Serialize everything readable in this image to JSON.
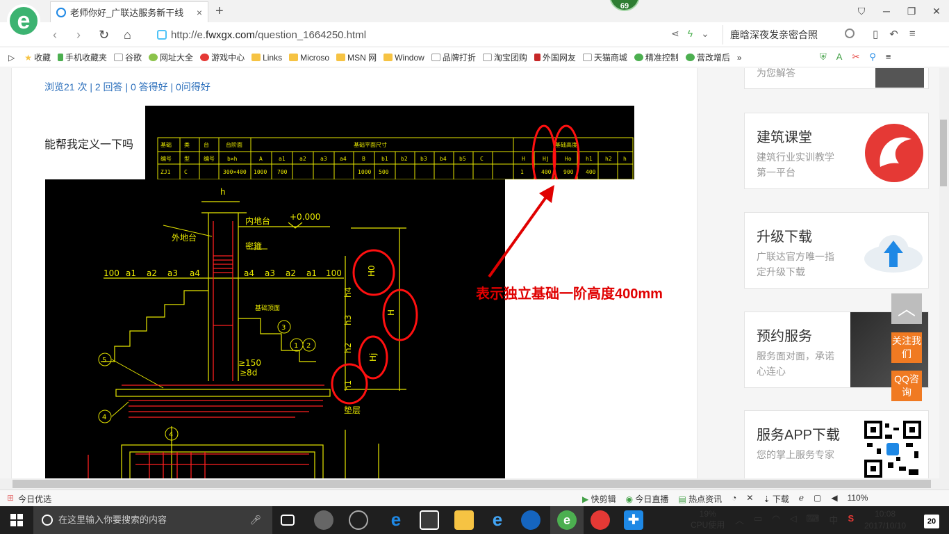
{
  "tab": {
    "title": "老师你好_广联达服务新干线",
    "close": "×",
    "new": "+"
  },
  "badge": "69",
  "window_controls": [
    "⛉",
    "─",
    "❐",
    "✕"
  ],
  "nav": {
    "back": "‹",
    "forward": "›",
    "reload": "↻",
    "home": "⌂",
    "url_prefix": "http://e.",
    "url_domain": "fwxgx.com",
    "url_path": "/question_1664250.html",
    "search_text": "鹿晗深夜发亲密合照"
  },
  "bookmarks": [
    "收藏",
    "手机收藏夹",
    "谷歌",
    "网址大全",
    "游戏中心",
    "Links",
    "Microso",
    "MSN 网",
    "Window",
    "品牌打折",
    "淘宝团购",
    "外国网友",
    "天猫商城",
    "精准控制",
    "营改增后"
  ],
  "bookmark_more": "»",
  "page": {
    "stats": "浏览21 次 | 2 回答 | 0 答得好 | 0问得好",
    "question": "能帮我定义一下吗",
    "annotation": "表示独立基础一阶高度400mm"
  },
  "sidebar": {
    "partial_text": "为您解答",
    "cards": [
      {
        "title": "建筑课堂",
        "desc": "建筑行业实训教学第一平台"
      },
      {
        "title": "升级下载",
        "desc": "广联达官方唯一指定升级下载"
      },
      {
        "title": "预约服务",
        "desc": "服务面对面，承诺心连心"
      },
      {
        "title": "服务APP下载",
        "desc": "您的掌上服务专家"
      }
    ]
  },
  "float": {
    "top": "︿",
    "follow": "关注我们",
    "qq": "QQ咨询"
  },
  "statusbar": {
    "left": "今日优选",
    "items": [
      "快剪辑",
      "今日直播",
      "热点资讯",
      "下载",
      "110%"
    ]
  },
  "taskbar": {
    "search_placeholder": "在这里输入你要搜索的内容",
    "cpu_pct": "19%",
    "cpu_label": "CPU使用",
    "ime": "中",
    "time": "10:08",
    "date": "2017/10/10",
    "notif": "20"
  },
  "cad": {
    "labels": [
      "h",
      "内地台",
      "外地台",
      "密箍",
      "+0.000",
      "基础顶面",
      "≥150",
      "≥8d",
      "垫层",
      "H0",
      "H",
      "Hj",
      "h1",
      "h2",
      "h3",
      "h4",
      "100",
      "a1",
      "a2",
      "a3",
      "a4",
      "a4",
      "a3",
      "a2",
      "a1",
      "100",
      "3",
      "1",
      "2",
      "5",
      "4",
      "4"
    ]
  },
  "colors": {
    "accent": "#2a6ebb",
    "annotation": "#e00000",
    "cad_line": "#e8e800",
    "cad_red": "#ff2020",
    "float_orange": "#f07a22"
  }
}
